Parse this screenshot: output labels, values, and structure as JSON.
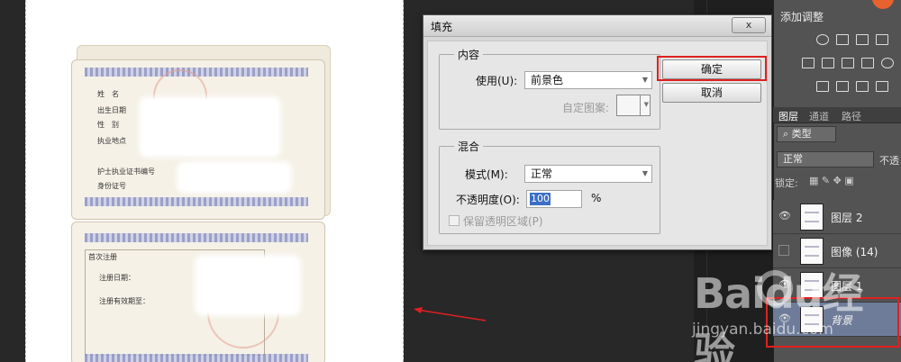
{
  "document": {
    "fields_top": [
      "姓　名",
      "出生日期",
      "性　别",
      "执业地点",
      "护士执业证书编号",
      "身份证号"
    ],
    "section_title": "首次注册",
    "fields_bottom": [
      "注册日期：",
      "注册有效期至："
    ]
  },
  "dialog": {
    "title": "填充",
    "close_label": "x",
    "content": {
      "legend": "内容",
      "use_label": "使用(U):",
      "use_value": "前景色",
      "pattern_label": "自定图案:"
    },
    "blend": {
      "legend": "混合",
      "mode_label": "模式(M):",
      "mode_value": "正常",
      "opacity_label": "不透明度(O):",
      "opacity_value": "100",
      "opacity_unit": "%",
      "preserve_label": "保留透明区域(P)"
    },
    "ok_label": "确定",
    "cancel_label": "取消"
  },
  "panel": {
    "adjust_title": "添加调整",
    "tabs": [
      "图层",
      "通道",
      "路径"
    ],
    "filter_label": "类型",
    "blend_mode": "正常",
    "opacity_label": "不透",
    "lock_label": "锁定:",
    "layers": [
      {
        "name": "图层 2"
      },
      {
        "name": "图像 (14)"
      },
      {
        "name": "图层 1"
      },
      {
        "name": "背景"
      }
    ]
  },
  "watermark": {
    "brand": "Baidu经验",
    "url": "jingyan.baidu.com"
  },
  "colors": {
    "highlight": "#e02020",
    "arrow": "#e02020",
    "selected_layer": "#6e7c99"
  }
}
